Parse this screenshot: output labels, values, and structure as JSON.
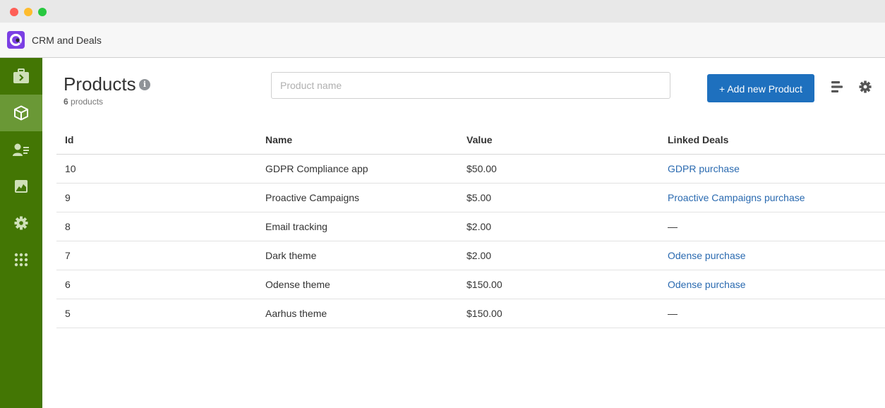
{
  "window": {
    "controls": [
      "close",
      "minimize",
      "maximize"
    ]
  },
  "app": {
    "title": "CRM and Deals",
    "logo_icon": "app-logo-icon"
  },
  "colors": {
    "sidebar": "#437604",
    "sidebar_active": "#6a9836",
    "primary_button": "#1e70be",
    "link": "#2a6ab0",
    "logo": "#7b3fe4"
  },
  "sidebar": {
    "items": [
      {
        "icon": "briefcase-icon",
        "active": false
      },
      {
        "icon": "box-icon",
        "active": true
      },
      {
        "icon": "contacts-icon",
        "active": false
      },
      {
        "icon": "chart-icon",
        "active": false
      },
      {
        "icon": "gear-icon",
        "active": false
      },
      {
        "icon": "apps-grid-icon",
        "active": false
      }
    ]
  },
  "page": {
    "title": "Products",
    "count": "6",
    "count_label": "products"
  },
  "search": {
    "placeholder": "Product name",
    "value": ""
  },
  "toolbar": {
    "add_label": "+ Add new Product",
    "columns_icon": "columns-icon",
    "settings_icon": "gear-icon"
  },
  "table": {
    "columns": [
      "Id",
      "Name",
      "Value",
      "Linked Deals"
    ],
    "rows": [
      {
        "id": "10",
        "name": "GDPR Compliance app",
        "value": "$50.00",
        "deal": "GDPR purchase"
      },
      {
        "id": "9",
        "name": "Proactive Campaigns",
        "value": "$5.00",
        "deal": "Proactive Campaigns purchase"
      },
      {
        "id": "8",
        "name": "Email tracking",
        "value": "$2.00",
        "deal": "—"
      },
      {
        "id": "7",
        "name": "Dark theme",
        "value": "$2.00",
        "deal": "Odense purchase"
      },
      {
        "id": "6",
        "name": "Odense theme",
        "value": "$150.00",
        "deal": "Odense purchase"
      },
      {
        "id": "5",
        "name": "Aarhus theme",
        "value": "$150.00",
        "deal": "—"
      }
    ]
  }
}
